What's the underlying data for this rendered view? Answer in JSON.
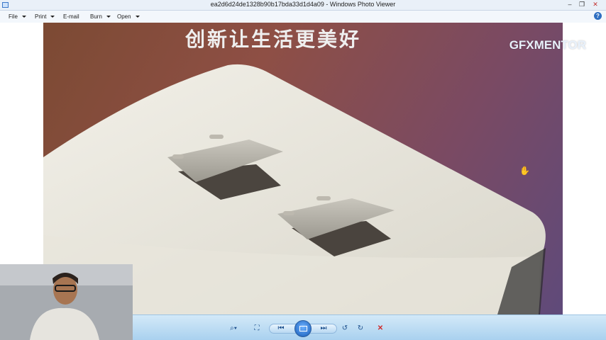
{
  "window": {
    "title": "ea2d6d24de1328b90b17bda33d1d4a09 - Windows Photo Viewer",
    "minimize": "–",
    "restore": "❐",
    "close": "✕"
  },
  "menu": {
    "file": "File",
    "print": "Print",
    "email": "E-mail",
    "burn": "Burn",
    "open": "Open",
    "help": "?"
  },
  "photo": {
    "overlay_text": "创新让生活更美好"
  },
  "brand": {
    "logo_text": "GFXMENTOR"
  },
  "toolbar": {
    "zoom_icon": "search-icon",
    "fit_icon": "fit-window-icon",
    "prev_icon": "previous-icon",
    "slideshow_icon": "slideshow-icon",
    "next_icon": "next-icon",
    "rotate_ccw_icon": "rotate-ccw-icon",
    "rotate_cw_icon": "rotate-cw-icon",
    "delete_icon": "delete-icon",
    "accent": "#1d4f8c",
    "delete_color": "#d02b2b"
  }
}
